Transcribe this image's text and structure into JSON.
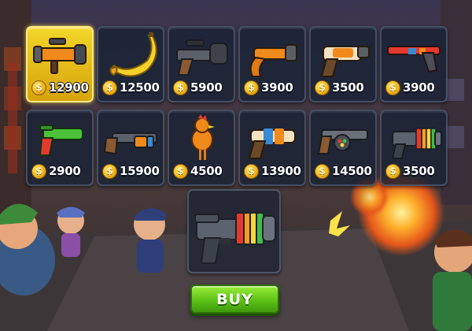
{
  "shop": {
    "currency_icon": "coin-icon",
    "coin_symbol": "$",
    "selected_index": 0,
    "items": [
      {
        "name": "bazooka",
        "price": "12900",
        "icon": "bazooka-icon"
      },
      {
        "name": "banana",
        "price": "12500",
        "icon": "banana-icon"
      },
      {
        "name": "scoped-launcher",
        "price": "5900",
        "icon": "scoped-launcher-icon"
      },
      {
        "name": "orange-pistol",
        "price": "3900",
        "icon": "orange-pistol-icon"
      },
      {
        "name": "cream-blaster",
        "price": "3500",
        "icon": "cream-blaster-icon"
      },
      {
        "name": "striped-rifle",
        "price": "3900",
        "icon": "striped-rifle-icon"
      },
      {
        "name": "green-blaster",
        "price": "2900",
        "icon": "green-blaster-icon"
      },
      {
        "name": "wooden-shotgun",
        "price": "15900",
        "icon": "wooden-shotgun-icon"
      },
      {
        "name": "rubber-chicken",
        "price": "4500",
        "icon": "rubber-chicken-icon"
      },
      {
        "name": "water-gun",
        "price": "13900",
        "icon": "water-gun-icon"
      },
      {
        "name": "candy-gun",
        "price": "14500",
        "icon": "candy-gun-icon"
      },
      {
        "name": "rainbow-gun",
        "price": "3500",
        "icon": "rainbow-gun-icon"
      }
    ],
    "preview_icon": "rainbow-blaster-preview-icon",
    "buy_label": "BUY"
  },
  "colors": {
    "selected": "#f3d62a",
    "buy_button": "#5cc216",
    "coin": "#f0b416",
    "slot_bg": "#18223a"
  }
}
